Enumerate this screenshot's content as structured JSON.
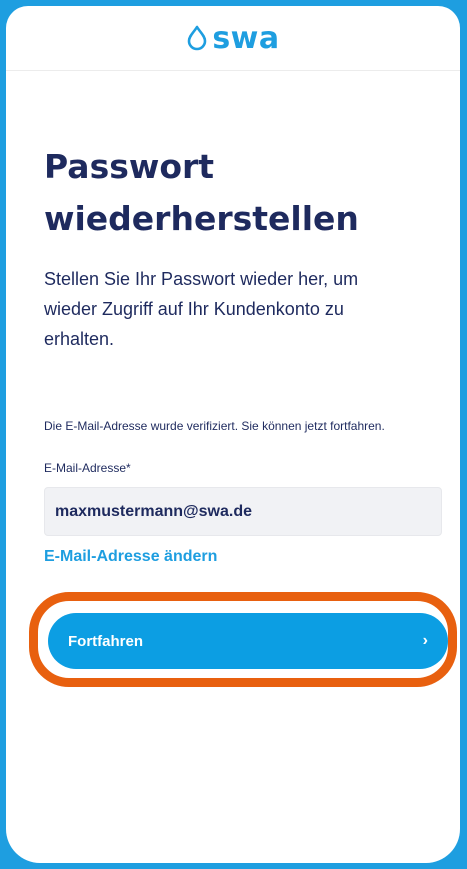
{
  "brand": {
    "name": "swa",
    "color": "#1e9ee0",
    "logo_icon": "drop-outline-icon"
  },
  "page": {
    "title": "Passwort wiederherstellen",
    "intro": "Stellen Sie Ihr Passwort wieder her, um wieder Zugriff auf Ihr Kundenkonto zu erhalten."
  },
  "form": {
    "verified_message": "Die E-Mail-Adresse wurde verifiziert. Sie können jetzt fortfahren.",
    "email_label": "E-Mail-Adresse*",
    "email_value": "maxmustermann@swa.de",
    "change_email_link": "E-Mail-Adresse ändern",
    "continue_label": "Fortfahren",
    "continue_icon": "chevron-right-icon"
  },
  "colors": {
    "background": "#1e9ee0",
    "primary_button": "#0c9ee3",
    "heading": "#1e2a5e",
    "highlight": "#e8600f"
  }
}
